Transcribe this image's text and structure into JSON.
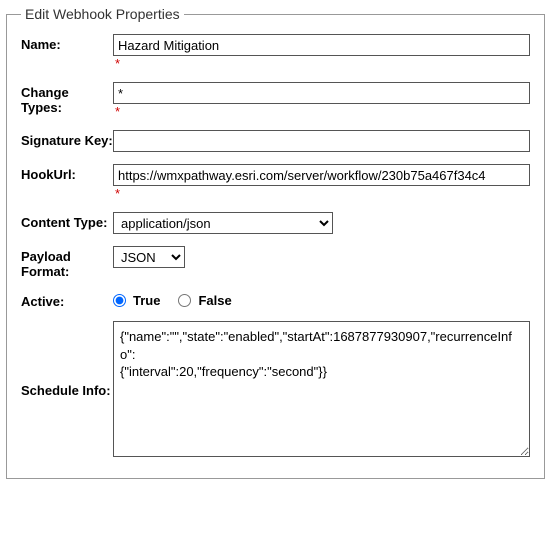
{
  "legend": "Edit Webhook Properties",
  "labels": {
    "name": "Name:",
    "changeTypes": "Change Types:",
    "signatureKey": "Signature Key:",
    "hookUrl": "HookUrl:",
    "contentType": "Content Type:",
    "payloadFormat": "Payload Format:",
    "active": "Active:",
    "scheduleInfo": "Schedule Info:"
  },
  "values": {
    "name": "Hazard Mitigation",
    "changeTypes": "*",
    "signatureKey": "",
    "hookUrl": "https://wmxpathway.esri.com/server/workflow/230b75a467f34c4",
    "contentType": "application/json",
    "payloadFormat": "JSON",
    "scheduleInfo": "{\"name\":\"\",\"state\":\"enabled\",\"startAt\":1687877930907,\"recurrenceInfo\":\n{\"interval\":20,\"frequency\":\"second\"}}"
  },
  "radio": {
    "trueLabel": "True",
    "falseLabel": "False"
  },
  "requiredMark": "*"
}
